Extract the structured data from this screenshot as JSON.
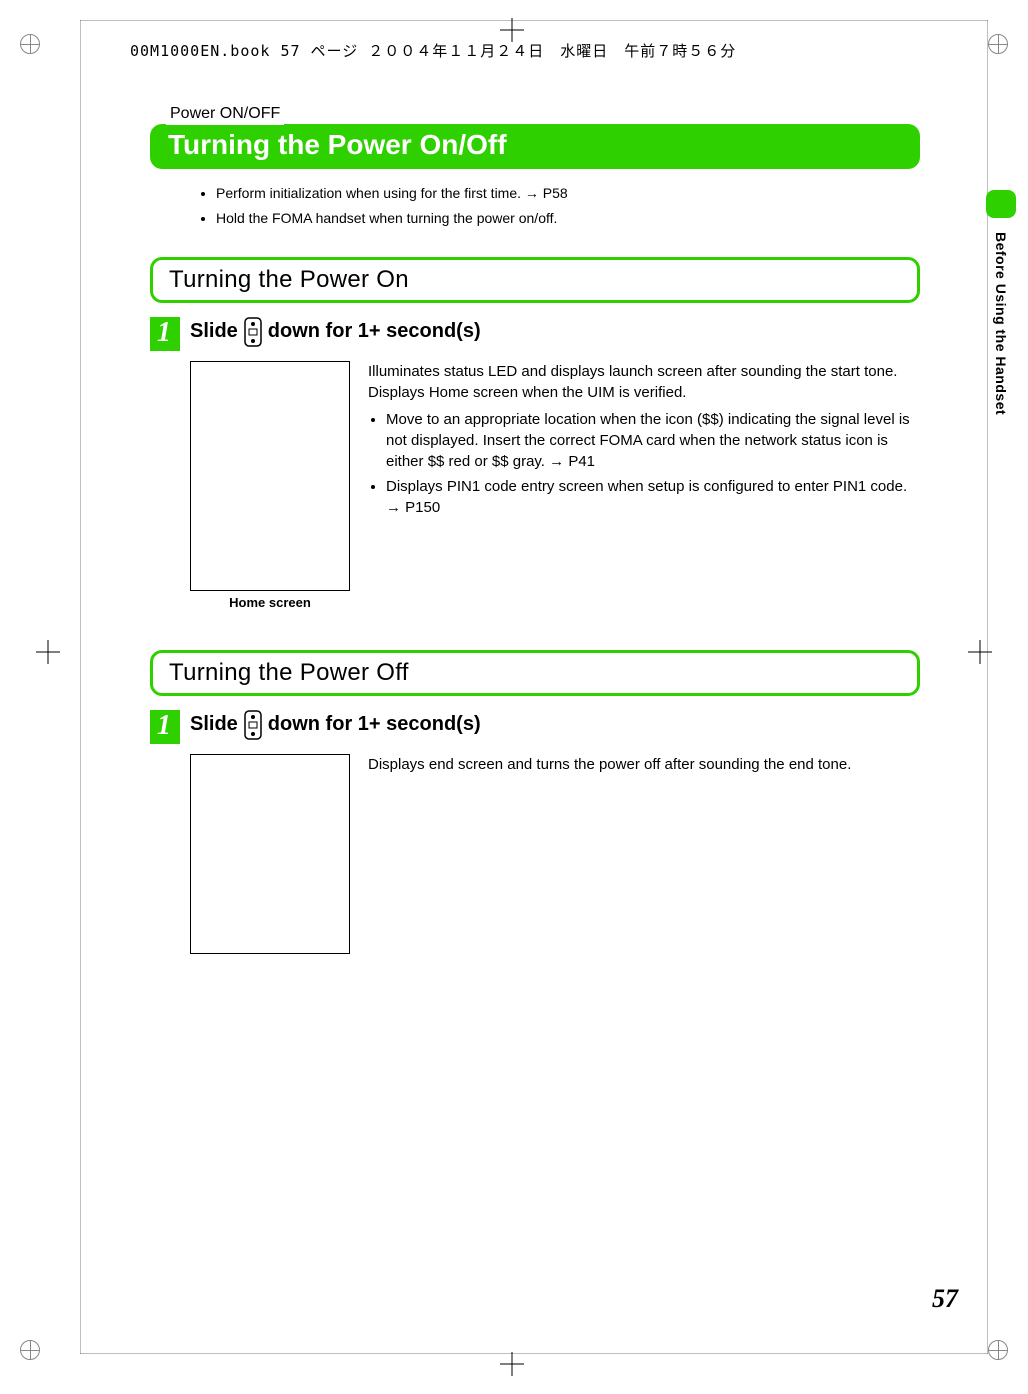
{
  "header_line": "00M1000EN.book  57 ページ  ２００４年１１月２４日　水曜日　午前７時５６分",
  "side_label": "Before Using the Handset",
  "page_number": "57",
  "section": {
    "tag": "Power ON/OFF",
    "title": "Turning the Power On/Off",
    "intro_bullets": [
      "Perform initialization when using for the first time. → P58",
      "Hold the FOMA handset when turning the power on/off."
    ]
  },
  "power_on": {
    "heading": "Turning the Power On",
    "step_num": "1",
    "step_before": "Slide",
    "step_after": "down for 1+ second(s)",
    "caption": "Home screen",
    "desc_p1": "Illuminates status LED and displays launch screen after sounding the start tone.",
    "desc_p2": "Displays Home screen when the UIM is verified.",
    "bullets": [
      "Move to an appropriate location when the icon ($$) indicating the signal level is not displayed. Insert the correct FOMA card when the network status icon is either $$ red or $$ gray. → P41",
      "Displays PIN1 code entry screen when setup is configured to enter PIN1 code. → P150"
    ]
  },
  "power_off": {
    "heading": "Turning the Power Off",
    "step_num": "1",
    "step_before": "Slide",
    "step_after": "down for 1+ second(s)",
    "desc_p1": "Displays end screen and turns the power off after sounding the end tone."
  }
}
